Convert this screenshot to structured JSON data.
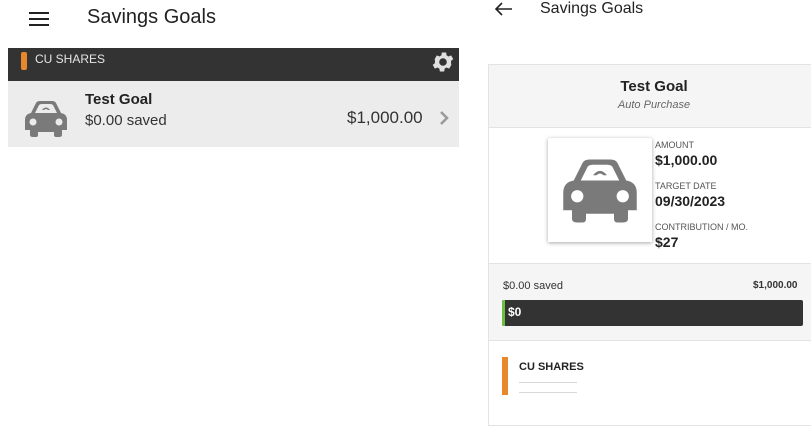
{
  "left": {
    "title": "Savings Goals",
    "section_label": "CU SHARES",
    "goal": {
      "name": "Test Goal",
      "saved": "$0.00 saved",
      "amount": "$1,000.00"
    }
  },
  "right": {
    "title": "Savings Goals",
    "goal_name": "Test Goal",
    "goal_category": "Auto Purchase",
    "amount_label": "AMOUNT",
    "amount_value": "$1,000.00",
    "target_date_label": "TARGET DATE",
    "target_date_value": "09/30/2023",
    "contribution_label": "CONTRIBUTION / MO.",
    "contribution_value": "$27",
    "saved_text": "$0.00 saved",
    "goal_total": "$1,000.00",
    "bar_text": "$0",
    "progress_fraction": 0.0,
    "account_label": "CU SHARES"
  },
  "colors": {
    "accent_orange": "#e8872b",
    "dark_bar": "#333333",
    "progress_green": "#6cbf3f",
    "icon_gray": "#7a7a7a"
  },
  "icons": [
    "menu-icon",
    "gear-icon",
    "car-icon",
    "chevron-right-icon",
    "back-arrow-icon"
  ]
}
